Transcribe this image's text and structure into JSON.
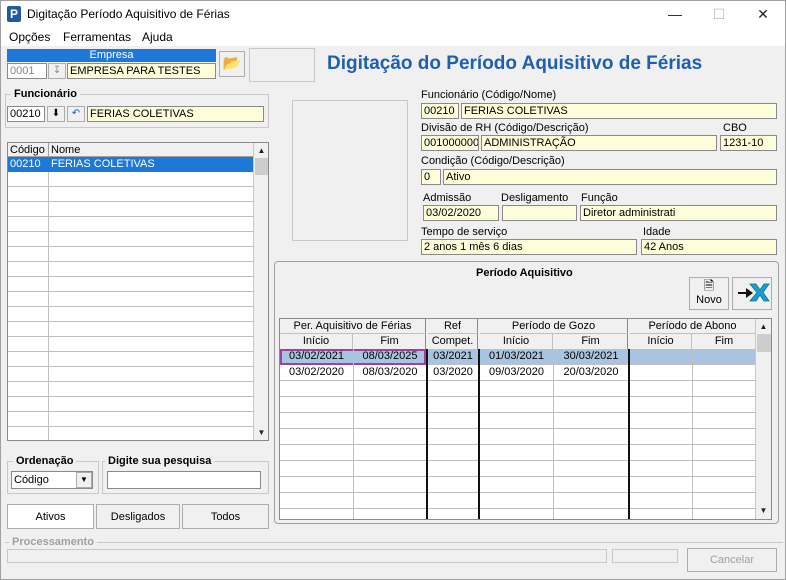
{
  "window": {
    "title": "Digitação Período Aquisitivo de Férias"
  },
  "menu": [
    "Opções",
    "Ferramentas",
    "Ajuda"
  ],
  "empresa": {
    "label": "Empresa",
    "code": "0001",
    "name": "EMPRESA PARA TESTES"
  },
  "heading": "Digitação do Período Aquisitivo de Férias",
  "funcionario_box": {
    "label": "Funcionário",
    "code": "00210",
    "name": "FERIAS COLETIVAS"
  },
  "list": {
    "headers": [
      "Código",
      "Nome"
    ],
    "rows": [
      {
        "code": "00210",
        "name": "FERIAS COLETIVAS"
      }
    ]
  },
  "ordenacao": {
    "label": "Ordenação",
    "value": "Código"
  },
  "pesquisa": {
    "label": "Digite sua pesquisa",
    "value": ""
  },
  "tabs": [
    "Ativos",
    "Desligados",
    "Todos"
  ],
  "details": {
    "func_label": "Funcionário (Código/Nome)",
    "func_code": "00210",
    "func_name": "FERIAS COLETIVAS",
    "div_label": "Divisão de RH (Código/Descrição)",
    "div_code": "001000000",
    "div_desc": "ADMINISTRAÇÃO",
    "cbo_label": "CBO",
    "cbo": "1231-10",
    "cond_label": "Condição (Código/Descrição)",
    "cond_code": "0",
    "cond_desc": "Ativo",
    "adm_label": "Admissão",
    "adm": "03/02/2020",
    "desl_label": "Desligamento",
    "desl": "",
    "funcao_label": "Função",
    "funcao": "Diretor administrati",
    "tempo_label": "Tempo de serviço",
    "tempo": "2 anos 1 mês 6 dias",
    "idade_label": "Idade",
    "idade": "42 Anos"
  },
  "periodo": {
    "title": "Período Aquisitivo",
    "novo": "Novo",
    "groups": [
      "Per. Aquisitivo de Férias",
      "Ref",
      "Período de Gozo",
      "Período de Abono"
    ],
    "subheaders": [
      "Início",
      "Fim",
      "Compet.",
      "Início",
      "Fim",
      "Início",
      "Fim"
    ],
    "rows": [
      [
        "03/02/2021",
        "08/03/2025",
        "03/2021",
        "01/03/2021",
        "30/03/2021",
        "",
        ""
      ],
      [
        "03/02/2020",
        "08/03/2020",
        "03/2020",
        "09/03/2020",
        "20/03/2020",
        "",
        ""
      ]
    ]
  },
  "processamento": {
    "label": "Processamento"
  },
  "cancelar": "Cancelar"
}
